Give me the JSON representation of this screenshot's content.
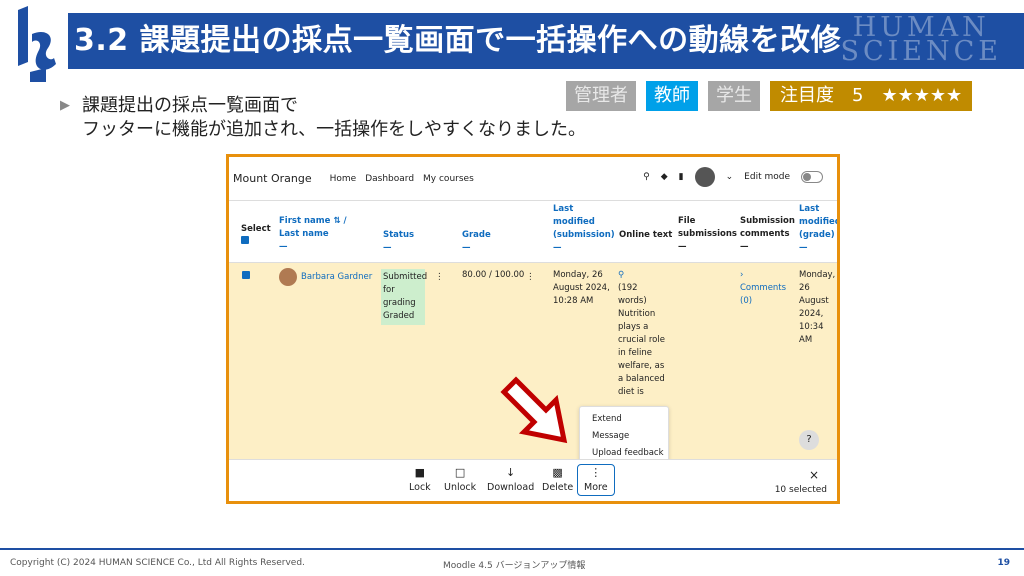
{
  "slide": {
    "title": "3.2 課題提出の採点一覧画面で一括操作への動線を改修",
    "brand_line1": "HUMAN",
    "brand_line2": "SCIENCE",
    "bullet_line1": "課題提出の採点一覧画面で",
    "bullet_line2": "フッターに機能が追加され、一括操作をしやすくなりました。",
    "tags": {
      "admin": "管理者",
      "teacher": "教師",
      "student": "学生",
      "attention": "注目度　5　★★★★★"
    },
    "footer_copyright": "Copyright (C) 2024 HUMAN SCIENCE Co., Ltd All Rights Reserved.",
    "footer_center": "Moodle 4.5 バージョンアップ情報",
    "page_number": "19"
  },
  "moodle": {
    "site_name": "Mount Orange",
    "nav": [
      "Home",
      "Dashboard",
      "My courses"
    ],
    "edit_mode": "Edit mode",
    "headers": {
      "select": "Select",
      "first_name": "First name",
      "last_name": "/ Last name",
      "status": "Status",
      "grade": "Grade",
      "last_modified_submission": "Last modified (submission)",
      "online_text": "Online text",
      "file_submissions": "File submissions",
      "submission_comments": "Submission comments",
      "last_modified_grade": "Last modified (grade)"
    },
    "row": {
      "name": "Barbara Gardner",
      "status": "Submitted for grading Graded",
      "grade": "80.00 / 100.00",
      "modified_submission": "Monday, 26 August 2024, 10:28 AM",
      "online_text": "(192 words) Nutrition plays a crucial role in feline welfare, as a balanced diet is essential for a cat's",
      "comments": "Comments (0)",
      "modified_grade": "Monday, 26 August 2024, 10:34 AM"
    },
    "more_menu": [
      "Extend",
      "Message",
      "Upload feedback"
    ],
    "footer_buttons": {
      "lock": "Lock",
      "unlock": "Unlock",
      "download": "Download",
      "delete": "Delete",
      "more": "More"
    },
    "selected_count": "10 selected",
    "close_symbol": "×",
    "help_symbol": "?"
  },
  "colors": {
    "title_bg": "#1e4fa3",
    "frame": "#e8900c",
    "row_highlight": "#fdefc6",
    "moodle_link": "#0f6cbf",
    "arrow": "#c00000"
  }
}
